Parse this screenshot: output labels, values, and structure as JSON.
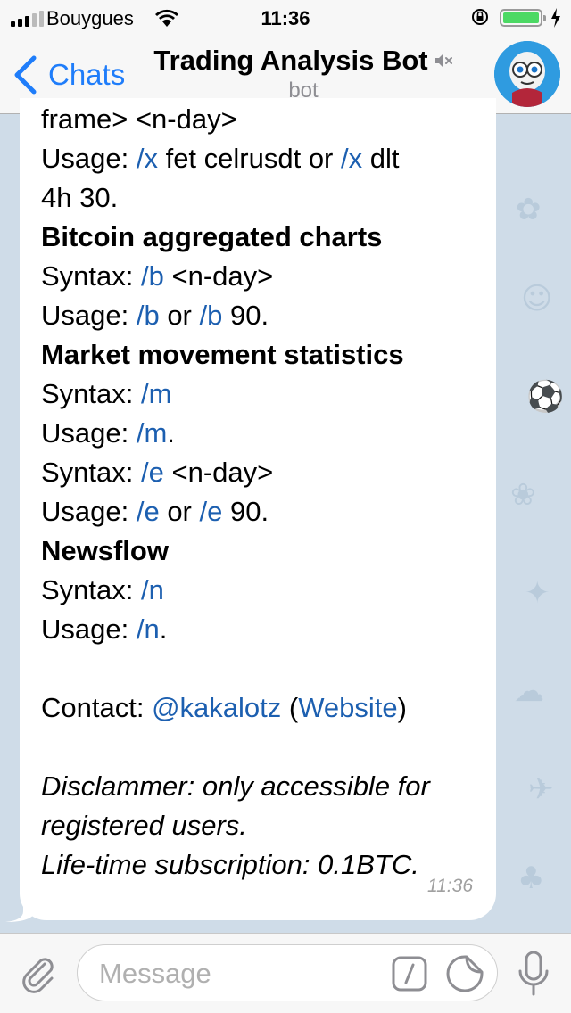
{
  "status_bar": {
    "carrier": "Bouygues",
    "time": "11:36"
  },
  "nav": {
    "back_label": "Chats",
    "title": "Trading Analysis Bot",
    "subtitle": "bot"
  },
  "message": {
    "lines": [
      {
        "parts": [
          {
            "t": "frame> <n-day>",
            "s": "text"
          }
        ]
      },
      {
        "parts": [
          {
            "t": "Usage: ",
            "s": "text"
          },
          {
            "t": "/x",
            "s": "cmd"
          },
          {
            "t": " fet celrusdt or ",
            "s": "text"
          },
          {
            "t": "/x",
            "s": "cmd"
          },
          {
            "t": " dlt",
            "s": "text"
          }
        ]
      },
      {
        "parts": [
          {
            "t": "4h 30.",
            "s": "text"
          }
        ]
      },
      {
        "parts": [
          {
            "t": "Bitcoin aggregated charts",
            "s": "bold"
          }
        ]
      },
      {
        "parts": [
          {
            "t": "Syntax: ",
            "s": "text"
          },
          {
            "t": "/b",
            "s": "cmd"
          },
          {
            "t": " <n-day>",
            "s": "text"
          }
        ]
      },
      {
        "parts": [
          {
            "t": "Usage: ",
            "s": "text"
          },
          {
            "t": "/b",
            "s": "cmd"
          },
          {
            "t": " or ",
            "s": "text"
          },
          {
            "t": "/b",
            "s": "cmd"
          },
          {
            "t": " 90.",
            "s": "text"
          }
        ]
      },
      {
        "parts": [
          {
            "t": "Market movement statistics",
            "s": "bold"
          }
        ]
      },
      {
        "parts": [
          {
            "t": "Syntax: ",
            "s": "text"
          },
          {
            "t": "/m",
            "s": "cmd"
          }
        ]
      },
      {
        "parts": [
          {
            "t": "Usage: ",
            "s": "text"
          },
          {
            "t": "/m",
            "s": "cmd"
          },
          {
            "t": ".",
            "s": "text"
          }
        ]
      },
      {
        "parts": [
          {
            "t": "Syntax: ",
            "s": "text"
          },
          {
            "t": "/e",
            "s": "cmd"
          },
          {
            "t": " <n-day>",
            "s": "text"
          }
        ]
      },
      {
        "parts": [
          {
            "t": "Usage: ",
            "s": "text"
          },
          {
            "t": "/e",
            "s": "cmd"
          },
          {
            "t": " or ",
            "s": "text"
          },
          {
            "t": "/e",
            "s": "cmd"
          },
          {
            "t": " 90.",
            "s": "text"
          }
        ]
      },
      {
        "parts": [
          {
            "t": "Newsflow",
            "s": "bold"
          }
        ]
      },
      {
        "parts": [
          {
            "t": "Syntax: ",
            "s": "text"
          },
          {
            "t": "/n",
            "s": "cmd"
          }
        ]
      },
      {
        "parts": [
          {
            "t": "Usage: ",
            "s": "text"
          },
          {
            "t": "/n",
            "s": "cmd"
          },
          {
            "t": ".",
            "s": "text"
          }
        ]
      },
      {
        "parts": []
      },
      {
        "parts": [
          {
            "t": "Contact: ",
            "s": "text"
          },
          {
            "t": "@kakalotz",
            "s": "link"
          },
          {
            "t": " (",
            "s": "text"
          },
          {
            "t": "Website",
            "s": "link"
          },
          {
            "t": ")",
            "s": "text"
          }
        ]
      },
      {
        "parts": []
      },
      {
        "parts": [
          {
            "t": "Disclammer: only accessible for",
            "s": "italic"
          }
        ]
      },
      {
        "parts": [
          {
            "t": "registered users.",
            "s": "italic"
          }
        ]
      },
      {
        "parts": [
          {
            "t": "Life-time subscription: 0.1BTC.",
            "s": "italic"
          }
        ]
      }
    ],
    "time": "11:36"
  },
  "input": {
    "placeholder": "Message"
  },
  "colors": {
    "accent": "#1f7dfa",
    "command_link": "#1c5fb0",
    "wallpaper": "#cfdce8",
    "battery": "#4cd964"
  },
  "icons": [
    "signal-icon",
    "wifi-icon",
    "orientation-lock-icon",
    "battery-icon",
    "charging-icon",
    "back-chevron-icon",
    "mute-icon",
    "bot-avatar",
    "attach-icon",
    "slash-command-icon",
    "sticker-icon",
    "microphone-icon"
  ]
}
